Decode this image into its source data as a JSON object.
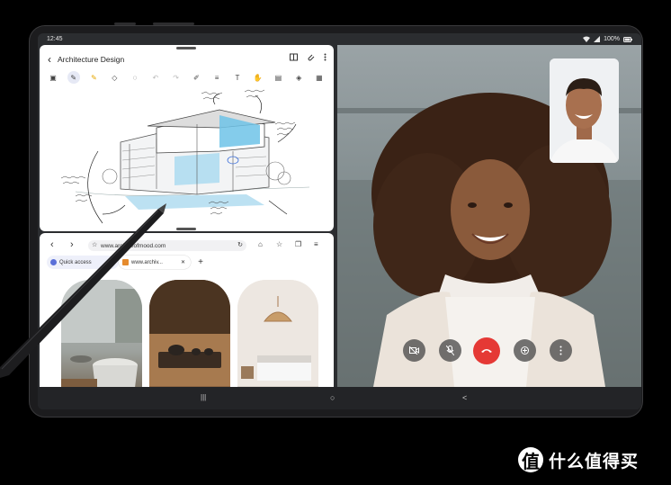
{
  "status_bar": {
    "time": "12:45",
    "battery": "100%",
    "wifi_icon": "wifi-icon",
    "signal_icon": "signal-icon"
  },
  "notes": {
    "title": "Architecture Design",
    "back_icon": "back-arrow-icon",
    "actions": [
      "book-icon",
      "attach-icon",
      "more-icon"
    ],
    "tools": [
      {
        "icon": "text-box-icon",
        "state": "normal"
      },
      {
        "icon": "pen-icon",
        "state": "active"
      },
      {
        "icon": "highlighter-icon",
        "state": "normal"
      },
      {
        "icon": "eraser-icon",
        "state": "normal"
      },
      {
        "icon": "lasso-icon",
        "state": "normal"
      },
      {
        "icon": "undo-icon",
        "state": "disabled"
      },
      {
        "icon": "redo-icon",
        "state": "disabled"
      },
      {
        "icon": "pen-settings-icon",
        "state": "normal"
      },
      {
        "icon": "text-style-icon",
        "state": "normal"
      },
      {
        "icon": "text-icon",
        "state": "normal"
      },
      {
        "icon": "hand-icon",
        "state": "normal"
      },
      {
        "icon": "media-icon",
        "state": "normal"
      },
      {
        "icon": "shapes-icon",
        "state": "normal"
      },
      {
        "icon": "pages-icon",
        "state": "normal"
      }
    ]
  },
  "browser": {
    "url": "www.archiveofmood.com",
    "tabs": [
      {
        "label": "Quick access"
      },
      {
        "label": "www.archiv..."
      }
    ],
    "new_tab_label": "+"
  },
  "video_call": {
    "controls": [
      "camera-off-icon",
      "mic-off-icon",
      "end-call-icon",
      "switch-camera-icon",
      "more-icon"
    ]
  },
  "navbar": {
    "recents": "|||",
    "home": "○",
    "back": "<"
  },
  "watermark": {
    "logo": "值",
    "text": "什么值得买"
  },
  "colors": {
    "accent": "#3d6fd9",
    "end_call": "#e53935",
    "device_frame": "#1c1c1e",
    "screen_bg": "#2b2d30"
  }
}
